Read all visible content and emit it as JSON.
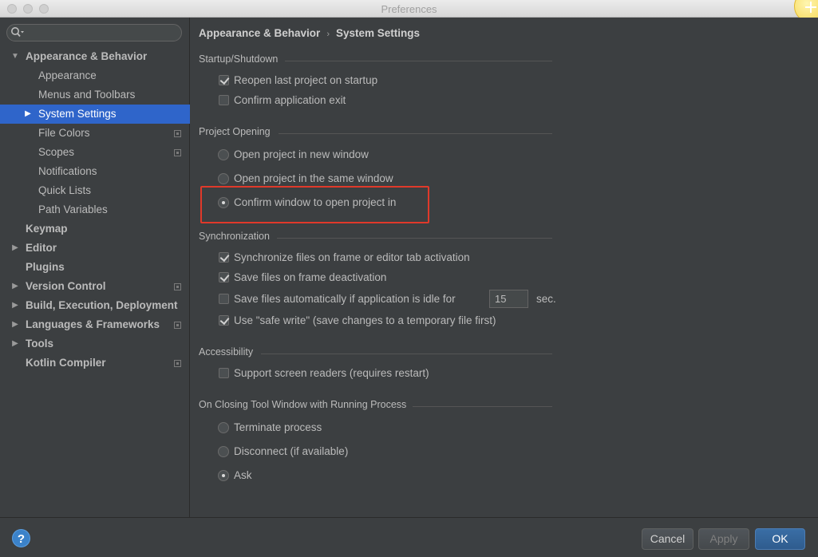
{
  "window": {
    "title": "Preferences"
  },
  "search": {
    "value": "",
    "placeholder": ""
  },
  "sidebar": {
    "items": [
      {
        "label": "Appearance & Behavior",
        "arrow": "▼"
      },
      {
        "label": "Appearance"
      },
      {
        "label": "Menus and Toolbars"
      },
      {
        "label": "System Settings",
        "arrow": "▶"
      },
      {
        "label": "File Colors"
      },
      {
        "label": "Scopes"
      },
      {
        "label": "Notifications"
      },
      {
        "label": "Quick Lists"
      },
      {
        "label": "Path Variables"
      },
      {
        "label": "Keymap"
      },
      {
        "label": "Editor",
        "arrow": "▶"
      },
      {
        "label": "Plugins"
      },
      {
        "label": "Version Control",
        "arrow": "▶"
      },
      {
        "label": "Build, Execution, Deployment",
        "arrow": "▶"
      },
      {
        "label": "Languages & Frameworks",
        "arrow": "▶"
      },
      {
        "label": "Tools",
        "arrow": "▶"
      },
      {
        "label": "Kotlin Compiler"
      }
    ]
  },
  "breadcrumb": {
    "parent": "Appearance & Behavior",
    "separator": "›",
    "current": "System Settings"
  },
  "groups": {
    "startup": {
      "title": "Startup/Shutdown",
      "reopen": "Reopen last project on startup",
      "confirm_exit": "Confirm application exit"
    },
    "project_opening": {
      "title": "Project Opening",
      "new_window": "Open project in new window",
      "same_window": "Open project in the same window",
      "confirm_window": "Confirm window to open project in"
    },
    "sync": {
      "title": "Synchronization",
      "sync_files": "Synchronize files on frame or editor tab activation",
      "save_deactivation": "Save files on frame deactivation",
      "save_idle": "Save files automatically if application is idle for",
      "idle_value": "15",
      "sec": "sec.",
      "safe_write": "Use \"safe write\" (save changes to a temporary file first)"
    },
    "accessibility": {
      "title": "Accessibility",
      "screen_readers": "Support screen readers (requires restart)"
    },
    "closing": {
      "title": "On Closing Tool Window with Running Process",
      "terminate": "Terminate process",
      "disconnect": "Disconnect (if available)",
      "ask": "Ask"
    }
  },
  "footer": {
    "help": "?",
    "cancel": "Cancel",
    "apply": "Apply",
    "ok": "OK"
  },
  "colors": {
    "selection": "#2f65ca",
    "highlight": "#e0392a",
    "primary": "#2f5c8e"
  }
}
